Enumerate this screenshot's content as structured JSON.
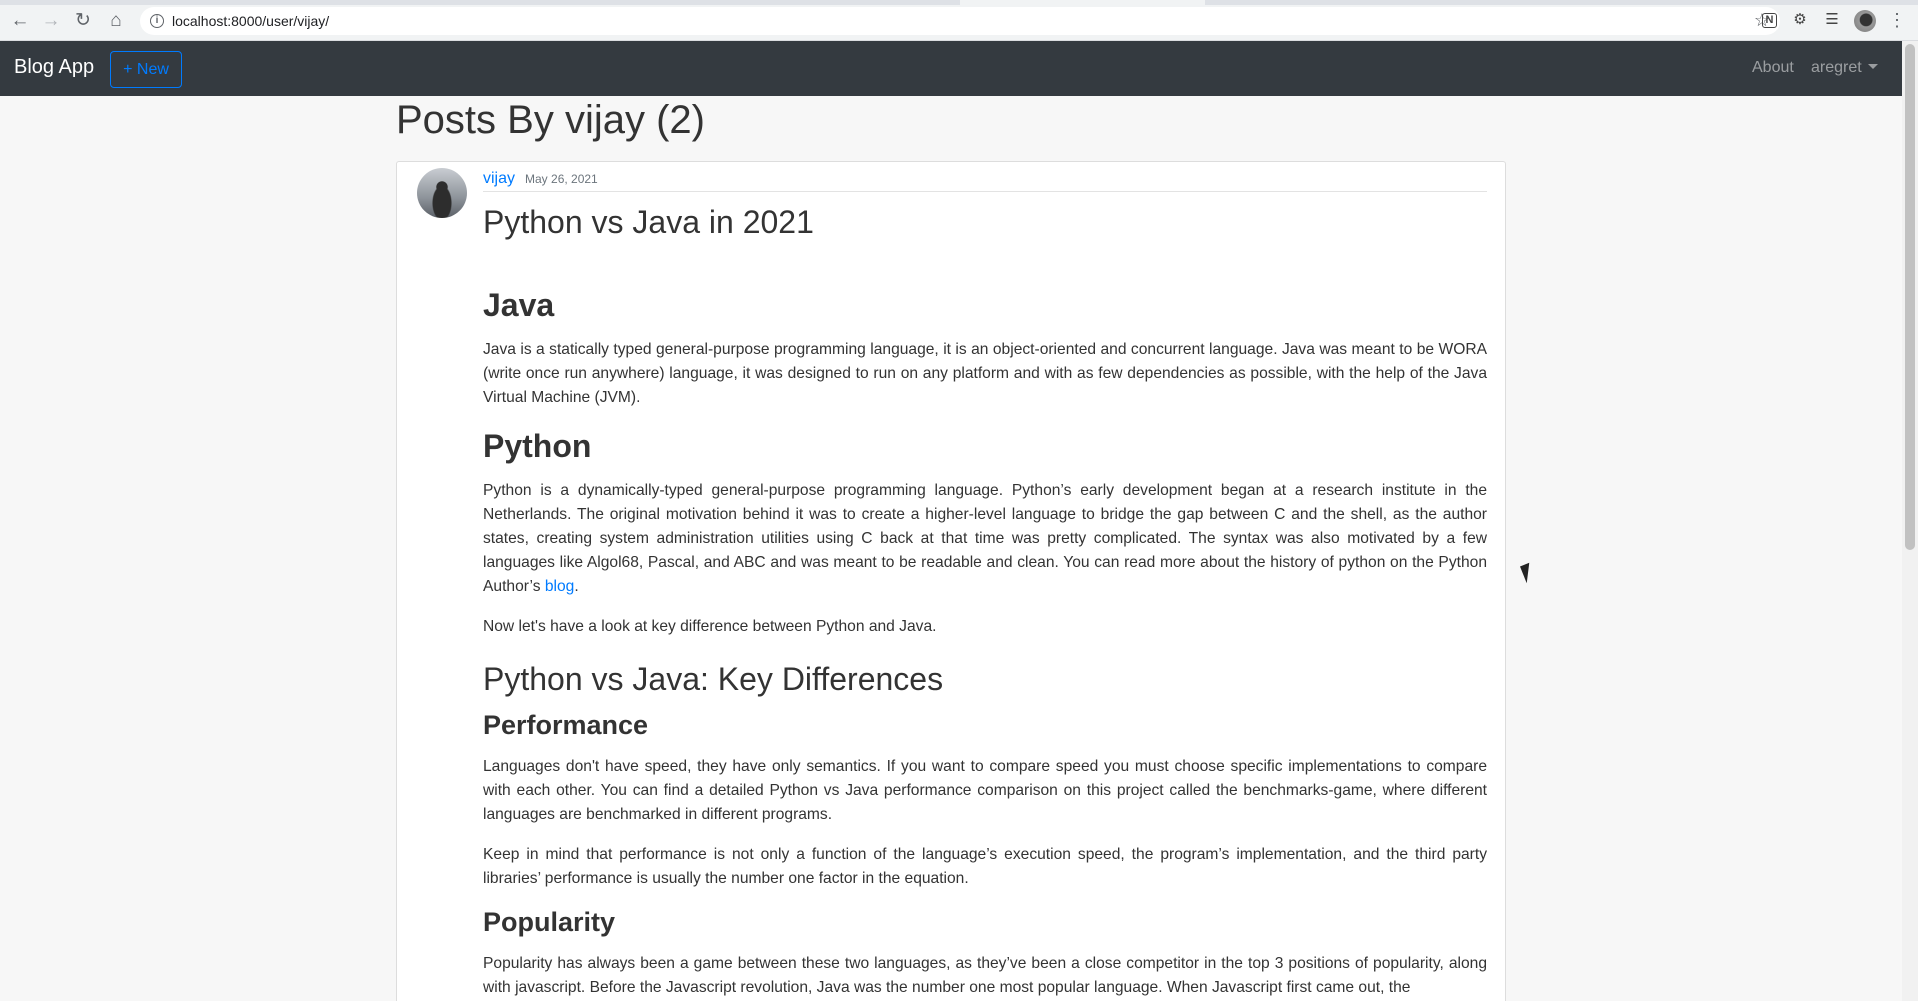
{
  "browser": {
    "url": "localhost:8000/user/vijay/",
    "back_icon": "arrow-left-icon",
    "forward_icon": "arrow-right-icon",
    "reload_icon": "reload-icon",
    "home_icon": "home-icon",
    "notion_label": "N"
  },
  "navbar": {
    "brand": "Blog App",
    "new_button": "+ New",
    "about": "About",
    "user": "aregret"
  },
  "page": {
    "title": "Posts By vijay (2)"
  },
  "post": {
    "author": "vijay",
    "date": "May 26, 2021",
    "title": "Python vs Java in 2021",
    "h_java": "Java",
    "p_java": "Java is a statically typed general-purpose programming language, it is an object-oriented and concurrent language. Java was meant to be WORA (write once run anywhere) language, it was designed to run on any platform and with as few dependencies as possible, with the help of the Java Virtual Machine (JVM).",
    "h_python": "Python",
    "p_python_before_link": "Python is a dynamically-typed general-purpose programming language. Python’s early development began at a research institute in the Netherlands. The original motivation behind it was to create a higher-level language to bridge the gap between C and the shell, as the author states, creating system administration utilities using C back at that time was pretty complicated. The syntax was also motivated by a few languages like Algol68, Pascal, and ABC and was meant to be readable and clean. You can read more about the history of python on the Python Author’s ",
    "p_python_link": "blog",
    "p_python_after_link": ".",
    "p_now": "Now let's have a look at key difference between Python and Java.",
    "h_diff": "Python vs Java: Key Differences",
    "h_perf": "Performance",
    "p_perf_1": "Languages don't have speed, they have only semantics. If you want to compare speed you must choose specific implementations to compare with each other. You can find a detailed Python vs Java performance comparison on this project called the benchmarks-game, where different languages are benchmarked in different programs.",
    "p_perf_2": "Keep in mind that performance is not only a function of the language’s execution speed, the program’s implementation, and the third party libraries’ performance is usually the number one factor in the equation.",
    "h_pop": "Popularity",
    "p_pop": "Popularity has always been a game between these two languages, as they’ve been a close competitor in the top 3 positions of popularity, along with javascript. Before the Javascript revolution, Java was the number one most popular language. When Javascript first came out, the"
  }
}
